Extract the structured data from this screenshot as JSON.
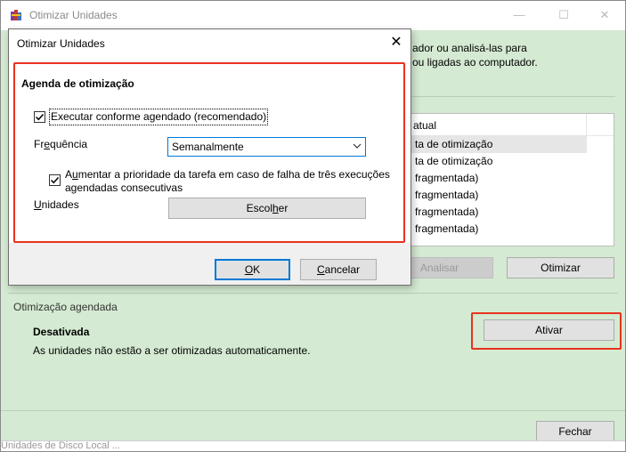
{
  "main": {
    "title": "Otimizar Unidades",
    "minimize_glyph": "—",
    "maximize_glyph": "☐",
    "close_glyph": "✕",
    "description_line1": "ador ou analisá-las para",
    "description_line2": "ou ligadas ao computador.",
    "list": {
      "column_header": "atual",
      "rows": [
        "ta de otimização",
        "ta de otimização",
        "fragmentada)",
        "fragmentada)",
        "fragmentada)",
        "fragmentada)"
      ]
    },
    "analyze_button": "Analisar",
    "optimize_button": "Otimizar",
    "scheduled_section_label": "Otimização agendada",
    "status_title": "Desativada",
    "status_description": "As unidades não estão a ser otimizadas automaticamente.",
    "activate_button": "Ativar",
    "close_button": "Fechar",
    "bottom_strip_text": "Unidades de Disco Local ..."
  },
  "dialog": {
    "title": "Otimizar Unidades",
    "close_glyph": "✕",
    "group_title": "Agenda de otimização",
    "run_scheduled": {
      "label": "Executar conforme agendado (recomendado)",
      "checked": true
    },
    "frequency": {
      "label_prefix": "Fr",
      "label_accel": "e",
      "label_rest": "quência",
      "value": "Semanalmente"
    },
    "priority": {
      "label_line1_prefix": "A",
      "label_line1_accel": "u",
      "label_line1_rest": "mentar a prioridade da tarefa em caso de falha de três execuções",
      "label_line2": "agendadas consecutivas",
      "checked": true
    },
    "drives": {
      "label_accel": "U",
      "label_rest": "nidades"
    },
    "choose_button": {
      "prefix": "Escol",
      "accel": "h",
      "rest": "er"
    },
    "ok_button": {
      "accel": "O",
      "rest": "K"
    },
    "cancel_button": {
      "accel": "C",
      "rest": "ancelar"
    }
  },
  "colors": {
    "window_bg": "#d4ead2",
    "highlight_red": "#e8321f",
    "accent_blue": "#0078d7"
  },
  "icons": {
    "app_icon": "defrag-app-icon",
    "check": "checkmark-icon",
    "combo_arrow": "chevron-down-icon"
  }
}
